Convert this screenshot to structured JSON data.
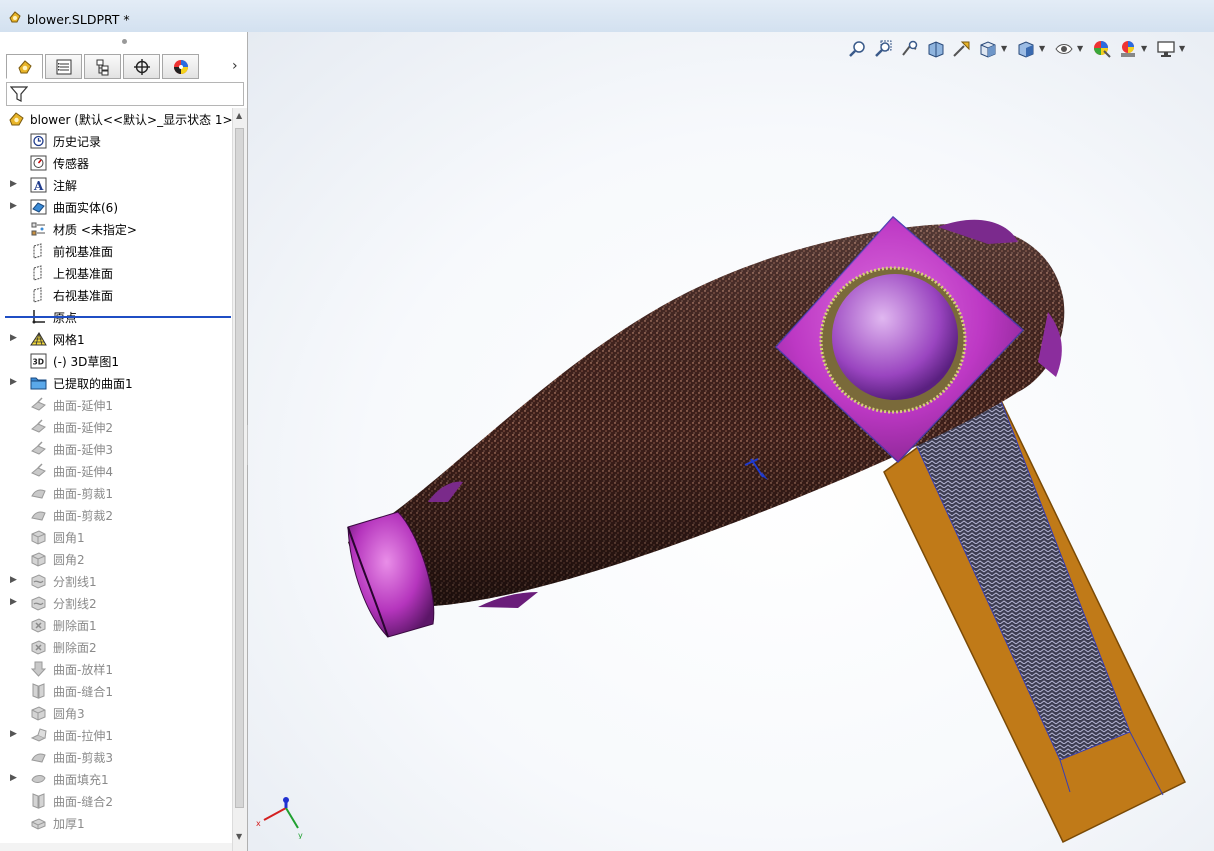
{
  "window": {
    "title": "blower.SLDPRT *"
  },
  "panel": {
    "tabs": [
      {
        "name": "feature-manager",
        "icon": "part-icon",
        "active": true
      },
      {
        "name": "property-manager",
        "icon": "properties-icon"
      },
      {
        "name": "configuration-manager",
        "icon": "configuration-icon"
      },
      {
        "name": "dimxpert-manager",
        "icon": "crosshair-icon"
      },
      {
        "name": "display-manager",
        "icon": "color-wheel-icon"
      }
    ],
    "more": "›"
  },
  "tree": {
    "root": {
      "label": "blower  (默认<<默认>_显示状态 1>",
      "icon": "part-icon"
    },
    "items": [
      {
        "label": "历史记录",
        "icon": "history-icon",
        "expandable": false,
        "dim": false
      },
      {
        "label": "传感器",
        "icon": "sensor-icon",
        "expandable": false,
        "dim": false
      },
      {
        "label": "注解",
        "icon": "annotation-icon",
        "expandable": true,
        "dim": false
      },
      {
        "label": "曲面实体(6)",
        "icon": "surface-bodies-icon",
        "expandable": true,
        "dim": false
      },
      {
        "label": "材质 <未指定>",
        "icon": "material-icon",
        "expandable": false,
        "dim": false
      },
      {
        "label": "前视基准面",
        "icon": "plane-icon",
        "expandable": false,
        "dim": false
      },
      {
        "label": "上视基准面",
        "icon": "plane-icon",
        "expandable": false,
        "dim": false
      },
      {
        "label": "右视基准面",
        "icon": "plane-icon",
        "expandable": false,
        "dim": false
      },
      {
        "label": "原点",
        "icon": "origin-icon",
        "expandable": false,
        "dim": false
      },
      {
        "label": "网格1",
        "icon": "mesh-icon",
        "expandable": true,
        "dim": false
      },
      {
        "label": "(-) 3D草图1",
        "icon": "sketch3d-icon",
        "expandable": false,
        "dim": false
      },
      {
        "label": "已提取的曲面1",
        "icon": "folder-icon",
        "expandable": true,
        "dim": false
      },
      {
        "label": "曲面-延伸1",
        "icon": "surface-extend-icon",
        "expandable": false,
        "dim": true
      },
      {
        "label": "曲面-延伸2",
        "icon": "surface-extend-icon",
        "expandable": false,
        "dim": true
      },
      {
        "label": "曲面-延伸3",
        "icon": "surface-extend-icon",
        "expandable": false,
        "dim": true
      },
      {
        "label": "曲面-延伸4",
        "icon": "surface-extend-icon",
        "expandable": false,
        "dim": true
      },
      {
        "label": "曲面-剪裁1",
        "icon": "surface-trim-icon",
        "expandable": false,
        "dim": true
      },
      {
        "label": "曲面-剪裁2",
        "icon": "surface-trim-icon",
        "expandable": false,
        "dim": true
      },
      {
        "label": "圆角1",
        "icon": "fillet-icon",
        "expandable": false,
        "dim": true
      },
      {
        "label": "圆角2",
        "icon": "fillet-icon",
        "expandable": false,
        "dim": true
      },
      {
        "label": "分割线1",
        "icon": "split-line-icon",
        "expandable": true,
        "dim": true
      },
      {
        "label": "分割线2",
        "icon": "split-line-icon",
        "expandable": true,
        "dim": true
      },
      {
        "label": "删除面1",
        "icon": "delete-face-icon",
        "expandable": false,
        "dim": true
      },
      {
        "label": "删除面2",
        "icon": "delete-face-icon",
        "expandable": false,
        "dim": true
      },
      {
        "label": "曲面-放样1",
        "icon": "surface-loft-icon",
        "expandable": false,
        "dim": true
      },
      {
        "label": "曲面-缝合1",
        "icon": "surface-knit-icon",
        "expandable": false,
        "dim": true
      },
      {
        "label": "圆角3",
        "icon": "fillet-icon",
        "expandable": false,
        "dim": true
      },
      {
        "label": "曲面-拉伸1",
        "icon": "surface-extrude-icon",
        "expandable": true,
        "dim": true
      },
      {
        "label": "曲面-剪裁3",
        "icon": "surface-trim-icon",
        "expandable": false,
        "dim": true
      },
      {
        "label": "曲面填充1",
        "icon": "surface-fill-icon",
        "expandable": true,
        "dim": true
      },
      {
        "label": "曲面-缝合2",
        "icon": "surface-knit-icon",
        "expandable": false,
        "dim": true
      },
      {
        "label": "加厚1",
        "icon": "thicken-icon",
        "expandable": false,
        "dim": true
      }
    ]
  },
  "heads_up_toolbar": [
    {
      "name": "zoom-to-fit",
      "icon": "zoom-fit-icon"
    },
    {
      "name": "zoom-to-area",
      "icon": "zoom-area-icon"
    },
    {
      "name": "previous-view",
      "icon": "previous-view-icon"
    },
    {
      "name": "section-view",
      "icon": "section-view-icon"
    },
    {
      "name": "dynamic-annotation",
      "icon": "annotation-view-icon"
    },
    {
      "name": "view-orientation",
      "icon": "view-orientation-icon",
      "dropdown": true
    },
    {
      "name": "display-style",
      "icon": "display-style-icon",
      "dropdown": true
    },
    {
      "name": "hide-show-items",
      "icon": "eye-icon",
      "dropdown": true
    },
    {
      "name": "edit-appearance",
      "icon": "appearance-icon"
    },
    {
      "name": "apply-scene",
      "icon": "scene-icon",
      "dropdown": true
    },
    {
      "name": "view-settings",
      "icon": "monitor-icon",
      "dropdown": true
    }
  ],
  "colors": {
    "body": "#4a2a22",
    "speckle": "#e2a488",
    "cap": "#c93dcf",
    "handle": "#c07a18",
    "grip": "#8a8aa6",
    "edge": "#3a3fb0"
  }
}
